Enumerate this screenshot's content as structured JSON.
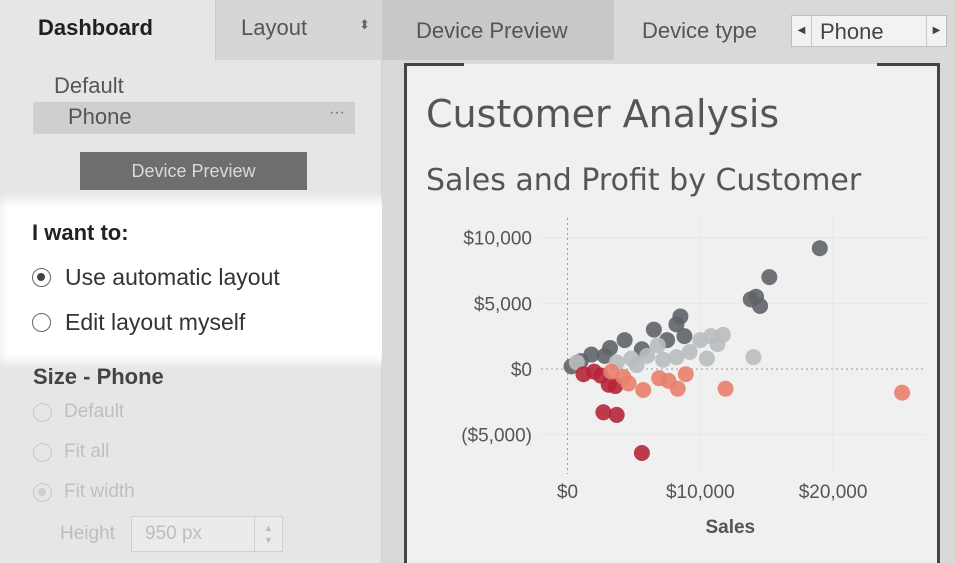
{
  "left_panel": {
    "tabs": {
      "dashboard": "Dashboard",
      "layout": "Layout"
    },
    "device_list": {
      "default": "Default",
      "selected": "Phone",
      "more": "···"
    },
    "device_preview_button": "Device Preview",
    "want_to": {
      "title": "I want to:",
      "options": [
        {
          "label": "Use automatic layout",
          "selected": true
        },
        {
          "label": "Edit layout myself",
          "selected": false
        }
      ]
    },
    "size": {
      "title": "Size - Phone",
      "options": [
        {
          "label": "Default",
          "selected": false
        },
        {
          "label": "Fit all",
          "selected": false
        },
        {
          "label": "Fit width",
          "selected": true
        }
      ],
      "height_label": "Height",
      "height_value": "950 px"
    }
  },
  "top_bar": {
    "device_preview_tab": "Device Preview",
    "device_type_label": "Device type",
    "device_type_value": "Phone"
  },
  "dashboard": {
    "title": "Customer Analysis",
    "chart_title": "Sales and Profit by Customer"
  },
  "colors": {
    "dark_gray": "#5f6468",
    "light_gray": "#b9bcbf",
    "red": "#b5263a",
    "salmon": "#e8806a"
  },
  "chart_data": {
    "type": "scatter",
    "title": "Sales and Profit by Customer",
    "xlabel": "Sales",
    "ylabel": "",
    "x_ticks": [
      "$0",
      "$10,000",
      "$20,000"
    ],
    "y_ticks": [
      "$10,000",
      "$5,000",
      "$0",
      "($5,000)"
    ],
    "xlim": [
      -2000,
      27000
    ],
    "ylim": [
      -8000,
      11500
    ],
    "points": [
      {
        "x": 19000,
        "y": 9200,
        "c": "dark"
      },
      {
        "x": 15200,
        "y": 7000,
        "c": "dark"
      },
      {
        "x": 14200,
        "y": 5500,
        "c": "dark"
      },
      {
        "x": 13800,
        "y": 5300,
        "c": "dark"
      },
      {
        "x": 14500,
        "y": 4800,
        "c": "dark"
      },
      {
        "x": 8500,
        "y": 4000,
        "c": "dark"
      },
      {
        "x": 8200,
        "y": 3400,
        "c": "dark"
      },
      {
        "x": 6500,
        "y": 3000,
        "c": "dark"
      },
      {
        "x": 10800,
        "y": 2500,
        "c": "light"
      },
      {
        "x": 11700,
        "y": 2600,
        "c": "light"
      },
      {
        "x": 10000,
        "y": 2200,
        "c": "light"
      },
      {
        "x": 11300,
        "y": 1900,
        "c": "light"
      },
      {
        "x": 8800,
        "y": 2500,
        "c": "dark"
      },
      {
        "x": 7500,
        "y": 2200,
        "c": "dark"
      },
      {
        "x": 6800,
        "y": 1800,
        "c": "light"
      },
      {
        "x": 4300,
        "y": 2200,
        "c": "dark"
      },
      {
        "x": 5600,
        "y": 1500,
        "c": "dark"
      },
      {
        "x": 3200,
        "y": 1600,
        "c": "dark"
      },
      {
        "x": 2800,
        "y": 1000,
        "c": "dark"
      },
      {
        "x": 1800,
        "y": 1100,
        "c": "dark"
      },
      {
        "x": 1000,
        "y": 600,
        "c": "dark"
      },
      {
        "x": 300,
        "y": 200,
        "c": "dark"
      },
      {
        "x": 700,
        "y": 500,
        "c": "light"
      },
      {
        "x": 4800,
        "y": 800,
        "c": "light"
      },
      {
        "x": 6000,
        "y": 1000,
        "c": "light"
      },
      {
        "x": 7200,
        "y": 700,
        "c": "light"
      },
      {
        "x": 8200,
        "y": 900,
        "c": "light"
      },
      {
        "x": 9200,
        "y": 1300,
        "c": "light"
      },
      {
        "x": 10500,
        "y": 800,
        "c": "light"
      },
      {
        "x": 14000,
        "y": 900,
        "c": "light"
      },
      {
        "x": 3700,
        "y": 500,
        "c": "light"
      },
      {
        "x": 5200,
        "y": 300,
        "c": "light"
      },
      {
        "x": 2000,
        "y": -200,
        "c": "red"
      },
      {
        "x": 1200,
        "y": -400,
        "c": "red"
      },
      {
        "x": 2500,
        "y": -500,
        "c": "red"
      },
      {
        "x": 3100,
        "y": -1200,
        "c": "red"
      },
      {
        "x": 3600,
        "y": -1300,
        "c": "red"
      },
      {
        "x": 2700,
        "y": -3300,
        "c": "red"
      },
      {
        "x": 3700,
        "y": -3500,
        "c": "red"
      },
      {
        "x": 5600,
        "y": -6400,
        "c": "red"
      },
      {
        "x": 3300,
        "y": -200,
        "c": "salmon"
      },
      {
        "x": 4200,
        "y": -600,
        "c": "salmon"
      },
      {
        "x": 4600,
        "y": -1100,
        "c": "salmon"
      },
      {
        "x": 5700,
        "y": -1600,
        "c": "salmon"
      },
      {
        "x": 6900,
        "y": -700,
        "c": "salmon"
      },
      {
        "x": 7600,
        "y": -900,
        "c": "salmon"
      },
      {
        "x": 8300,
        "y": -1500,
        "c": "salmon"
      },
      {
        "x": 8900,
        "y": -400,
        "c": "salmon"
      },
      {
        "x": 11900,
        "y": -1500,
        "c": "salmon"
      },
      {
        "x": 25200,
        "y": -1800,
        "c": "salmon"
      }
    ]
  }
}
